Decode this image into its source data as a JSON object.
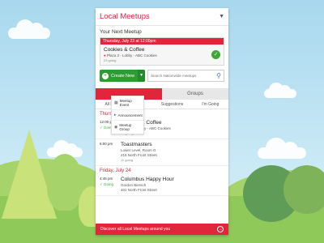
{
  "app": {
    "title": "Local Meetups"
  },
  "next_meetup": {
    "heading": "Your Next Meetup",
    "date": "Thursday, July 23 at 12:00pm",
    "title": "Cookies & Coffee",
    "location": "Plaza 3 - Lobby - ABC Cookies",
    "going": "23 going"
  },
  "actions": {
    "create_label": "Create New",
    "search_placeholder": "Search Nationwide meetups"
  },
  "create_menu": [
    {
      "label": "Meetup Event",
      "icon": "calendar-icon"
    },
    {
      "label": "Announcement",
      "icon": "megaphone-icon"
    },
    {
      "label": "Meetup Group",
      "icon": "group-icon"
    }
  ],
  "tabs": {
    "left": "",
    "right": "Groups"
  },
  "subtabs": [
    "All M",
    "etups",
    "Suggestions",
    "I'm Going"
  ],
  "days": [
    {
      "label": "Thursday, July 23",
      "events": [
        {
          "time": "12:00 pm",
          "going_label": "Going",
          "title": "Cookies & Coffee",
          "detail1": "Plaza 3 - Lobby - ABC Cookies",
          "detail2": "",
          "count": "23 going"
        },
        {
          "time": "6:00 pm",
          "going_label": "",
          "title": "Toastmasters",
          "detail1": "Lower Level, Room G",
          "detail2": "215 North Front Street",
          "count": "11 going"
        }
      ]
    },
    {
      "label": "Friday, July 24",
      "events": [
        {
          "time": "4:45 pm",
          "going_label": "Going",
          "title": "Columbus Happy Hour",
          "detail1": "Gordon Biersch",
          "detail2": "401 North Front Street",
          "count": ""
        }
      ]
    }
  ],
  "footer": {
    "label": "Discover all Local Meetups around you"
  },
  "colors": {
    "accent": "#e0263a",
    "green": "#2f9b35"
  }
}
